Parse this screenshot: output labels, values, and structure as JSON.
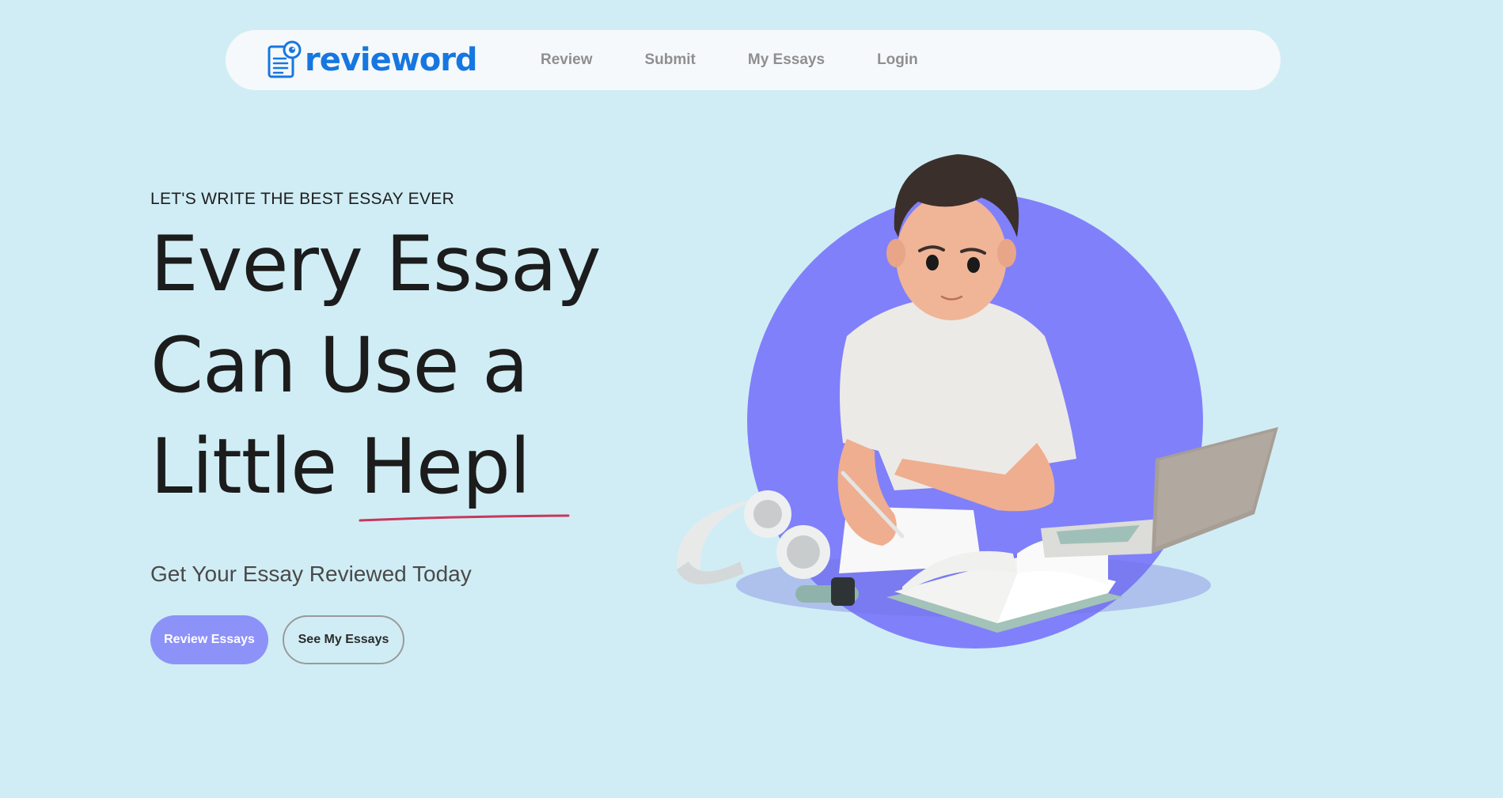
{
  "brand": {
    "name": "revieword",
    "accent_color": "#1677e0"
  },
  "nav": {
    "items": [
      {
        "label": "Review"
      },
      {
        "label": "Submit"
      },
      {
        "label": "My Essays"
      },
      {
        "label": "Login"
      }
    ]
  },
  "hero": {
    "eyebrow": "LET'S WRITE THE BEST ESSAY EVER",
    "headline_lines": [
      "Every Essay",
      "Can Use a",
      "Little Hepl"
    ],
    "subheading": "Get Your Essay Reviewed Today",
    "primary_button": "Review Essays",
    "secondary_button": "See My Essays",
    "primary_color": "#8d92f8",
    "underline_color": "#c7385b",
    "circle_color": "#8080fb",
    "background_color": "#d0edf5"
  },
  "illustration": {
    "subject": "3d-student-writing-essay",
    "icons": [
      "headphones-icon",
      "laptop-icon",
      "open-book-icon",
      "paper-icon",
      "smartwatch-icon"
    ]
  }
}
